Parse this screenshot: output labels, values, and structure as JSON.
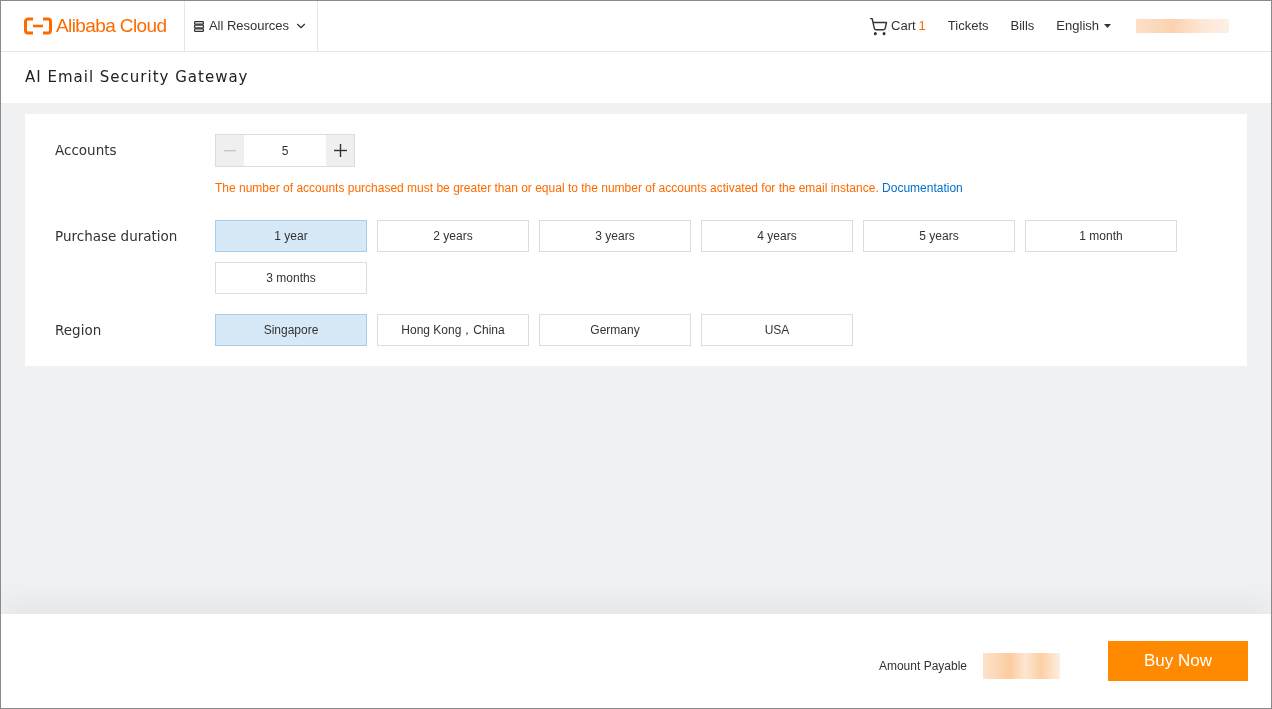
{
  "header": {
    "logo": "Alibaba Cloud",
    "resources_menu": "All Resources",
    "nav": [
      {
        "kind": "cart",
        "label": "Cart",
        "count": "1"
      },
      {
        "kind": "link",
        "label": "Tickets"
      },
      {
        "kind": "link",
        "label": "Bills"
      },
      {
        "kind": "dropdown",
        "label": "English"
      }
    ]
  },
  "page_title": "AI Email Security Gateway",
  "form": {
    "accounts": {
      "label": "Accounts",
      "value": "5",
      "decrement_disabled": true,
      "hint": "The number of accounts purchased must be greater than or equal to the number of accounts activated for the email instance.",
      "link": "Documentation"
    },
    "duration": {
      "label": "Purchase duration",
      "options": [
        {
          "label": "1 year",
          "selected": true
        },
        {
          "label": "2 years",
          "selected": false
        },
        {
          "label": "3 years",
          "selected": false
        },
        {
          "label": "4 years",
          "selected": false
        },
        {
          "label": "5 years",
          "selected": false
        },
        {
          "label": "1 month",
          "selected": false
        },
        {
          "label": "3 months",
          "selected": false
        }
      ]
    },
    "region": {
      "label": "Region",
      "options": [
        {
          "label": "Singapore",
          "selected": true
        },
        {
          "label": "Hong Kong，China",
          "selected": false
        },
        {
          "label": "Germany",
          "selected": false
        },
        {
          "label": "USA",
          "selected": false
        }
      ]
    }
  },
  "footer": {
    "amount_label": "Amount Payable",
    "buy_button": "Buy Now"
  }
}
